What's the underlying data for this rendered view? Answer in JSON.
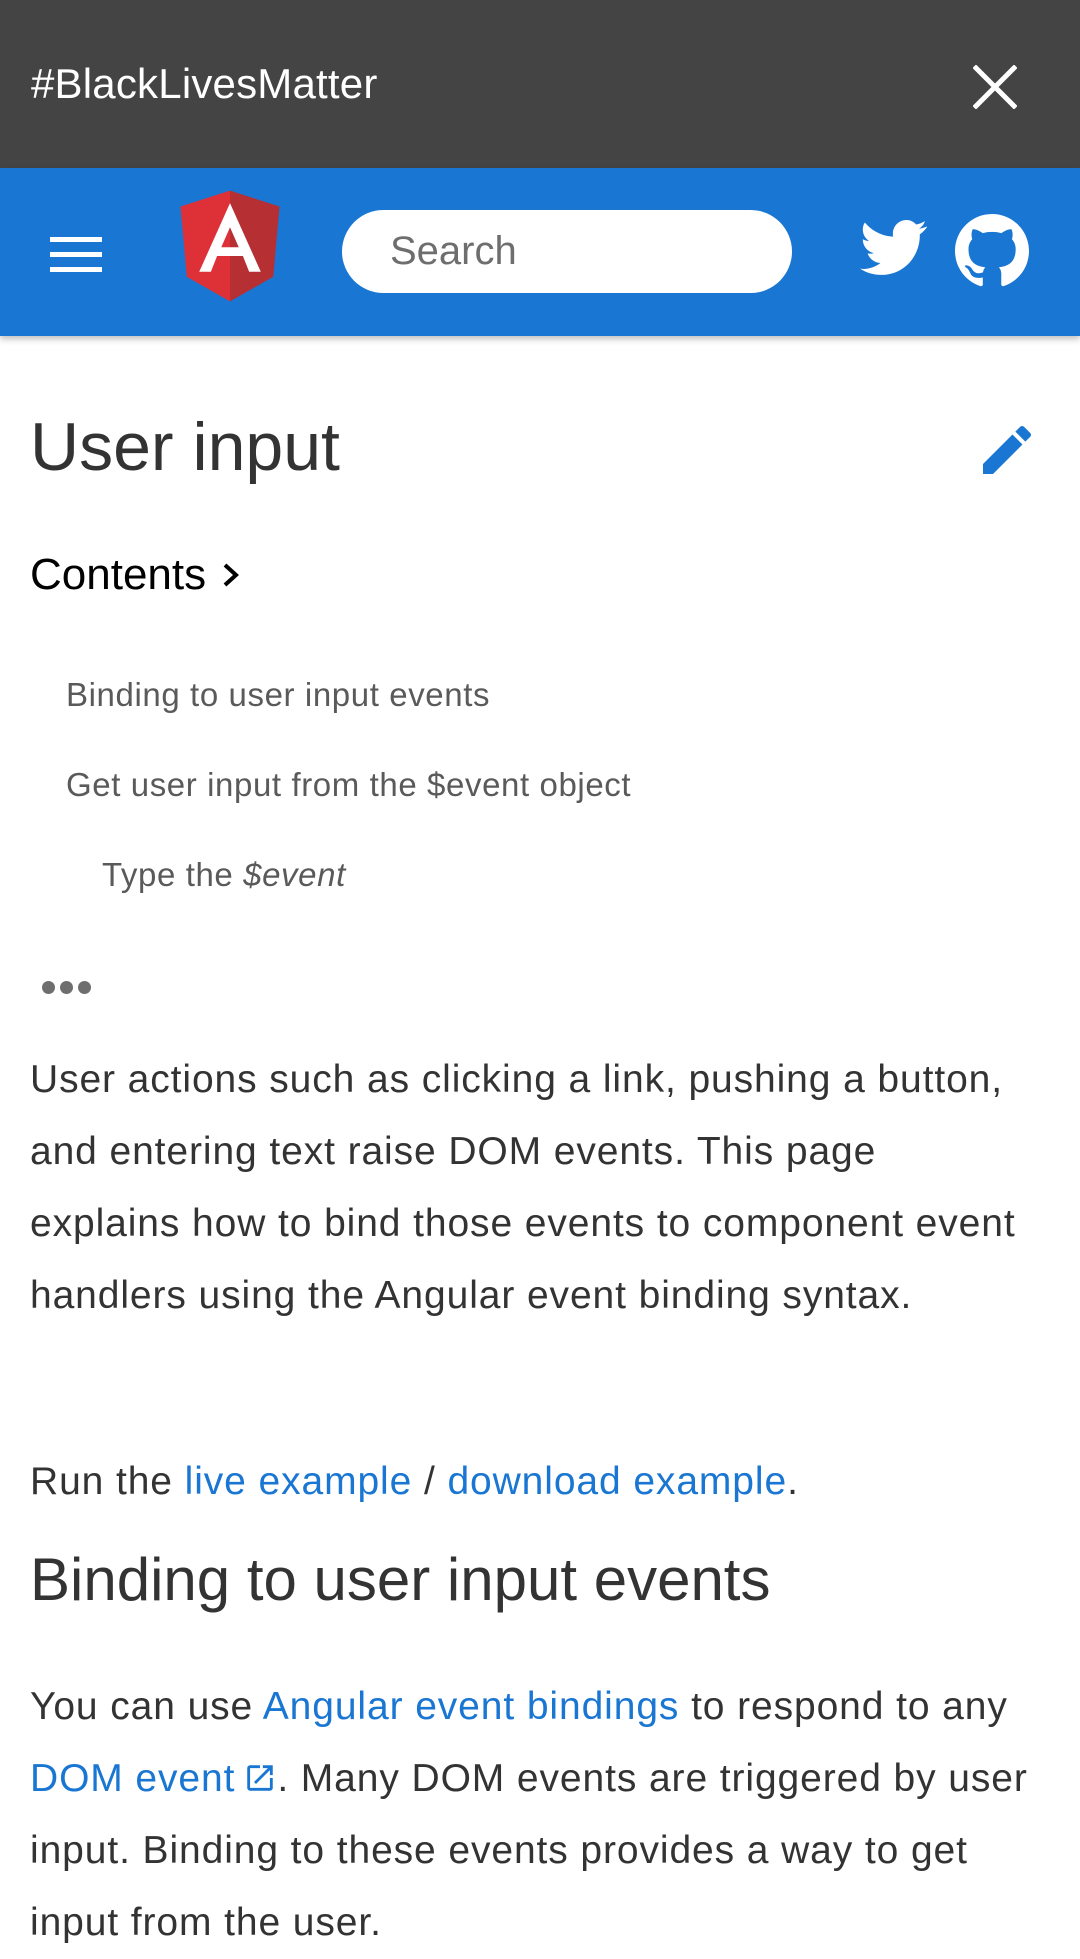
{
  "banner": {
    "text": "#BlackLivesMatter",
    "close_icon": "close-icon"
  },
  "toolbar": {
    "menu_icon": "hamburger-menu-icon",
    "logo": "angular-logo",
    "search_placeholder": "Search",
    "search_value": "",
    "social": [
      "twitter-icon",
      "github-icon"
    ],
    "colors": {
      "toolbar": "#1976d2",
      "banner": "#444444",
      "logo_left": "#dd3137",
      "logo_right": "#b52f33"
    }
  },
  "page": {
    "title": "User input",
    "edit_icon": "pencil-edit-icon",
    "contents_label": "Contents",
    "toc": [
      {
        "label": "Binding to user input events"
      },
      {
        "label": "Get user input from the $event object"
      },
      {
        "label_prefix": "Type the ",
        "label_em": "$event"
      }
    ],
    "toc_more_icon": "more-horiz-icon"
  },
  "content": {
    "intro": "User actions such as clicking a link, pushing a button, and entering text raise DOM events. This page explains how to bind those events to component event handlers using the Angular event binding syntax.",
    "run_prefix": "Run the ",
    "live_example": "live example",
    "separator": " / ",
    "download_example": "download example",
    "run_suffix": ".",
    "section_heading": "Binding to user input events",
    "section_p_prefix": "You can use ",
    "section_link1": "Angular event bindings",
    "section_p_mid1": " to respond to any ",
    "section_link2": "DOM event",
    "section_p_rest": ". Many DOM events are triggered by user input. Binding to these events provides a way to get input from the user.",
    "link_color": "#1976d2"
  }
}
